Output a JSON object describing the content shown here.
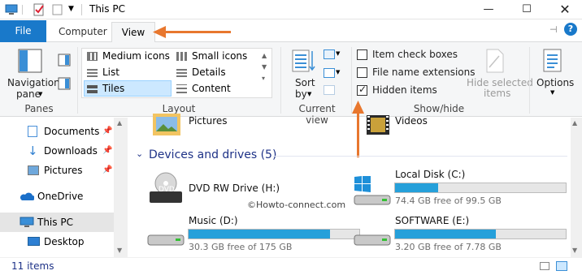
{
  "window": {
    "title": "This PC"
  },
  "tabs": {
    "file": "File",
    "computer": "Computer",
    "view": "View"
  },
  "ribbon": {
    "panes": {
      "nav_pane_line1": "Navigation",
      "nav_pane_line2": "pane",
      "group": "Panes"
    },
    "layout": {
      "items": [
        "Medium icons",
        "Small icons",
        "List",
        "Details",
        "Tiles",
        "Content"
      ],
      "selected": "Tiles",
      "group": "Layout"
    },
    "current_view": {
      "sort_line1": "Sort",
      "sort_line2": "by",
      "group": "Current view"
    },
    "show_hide": {
      "item_check_boxes": "Item check boxes",
      "file_name_extensions": "File name extensions",
      "hidden_items": "Hidden items",
      "hide_selected_line1": "Hide selected",
      "hide_selected_line2": "items",
      "group": "Show/hide"
    },
    "options": "Options"
  },
  "nav": {
    "items": [
      "Documents",
      "Downloads",
      "Pictures",
      "OneDrive",
      "This PC",
      "Desktop"
    ],
    "selected": "This PC"
  },
  "content": {
    "folders": [
      "Pictures",
      "Videos"
    ],
    "section_title": "Devices and drives (5)",
    "drives": [
      {
        "name": "DVD RW Drive (H:)",
        "free": "",
        "fill": null
      },
      {
        "name": "Local Disk (C:)",
        "free": "74.4 GB free of 99.5 GB",
        "fill": 0.25
      },
      {
        "name": "Music (D:)",
        "free": "30.3 GB free of 175 GB",
        "fill": 0.83
      },
      {
        "name": "SOFTWARE (E:)",
        "free": "3.20 GB free of 7.78 GB",
        "fill": 0.59
      }
    ],
    "watermark": "©Howto-connect.com",
    "dvd_badge": "DVD"
  },
  "status": {
    "items": "11 items"
  },
  "colors": {
    "accent": "#1979ca",
    "annotation": "#e8772e",
    "bar_fill": "#26a0da"
  }
}
